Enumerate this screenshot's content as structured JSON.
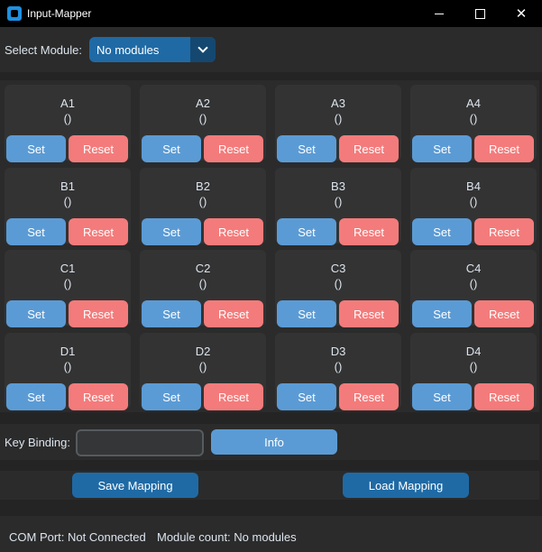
{
  "window": {
    "title": "Input-Mapper",
    "controls": {
      "minimize": "minimize",
      "maximize": "maximize",
      "close": "close"
    }
  },
  "module_select": {
    "label": "Select Module:",
    "value": "No modules"
  },
  "grid": {
    "set_label": "Set",
    "reset_label": "Reset",
    "cells": [
      {
        "name": "A1",
        "binding": "()"
      },
      {
        "name": "A2",
        "binding": "()"
      },
      {
        "name": "A3",
        "binding": "()"
      },
      {
        "name": "A4",
        "binding": "()"
      },
      {
        "name": "B1",
        "binding": "()"
      },
      {
        "name": "B2",
        "binding": "()"
      },
      {
        "name": "B3",
        "binding": "()"
      },
      {
        "name": "B4",
        "binding": "()"
      },
      {
        "name": "C1",
        "binding": "()"
      },
      {
        "name": "C2",
        "binding": "()"
      },
      {
        "name": "C3",
        "binding": "()"
      },
      {
        "name": "C4",
        "binding": "()"
      },
      {
        "name": "D1",
        "binding": "()"
      },
      {
        "name": "D2",
        "binding": "()"
      },
      {
        "name": "D3",
        "binding": "()"
      },
      {
        "name": "D4",
        "binding": "()"
      }
    ]
  },
  "key_binding": {
    "label": "Key Binding:",
    "value": "",
    "info_label": "Info"
  },
  "mapping": {
    "save_label": "Save Mapping",
    "load_label": "Load Mapping"
  },
  "status": {
    "com_port": "COM Port: Not Connected",
    "module_count": "Module count: No modules"
  },
  "colors": {
    "set_button": "#5b9bd5",
    "reset_button": "#f47b7b",
    "primary_button": "#1f6aa5",
    "cell_bg": "#333333"
  },
  "icons": {
    "app": "app-icon",
    "dropdown": "chevron-down-icon"
  }
}
